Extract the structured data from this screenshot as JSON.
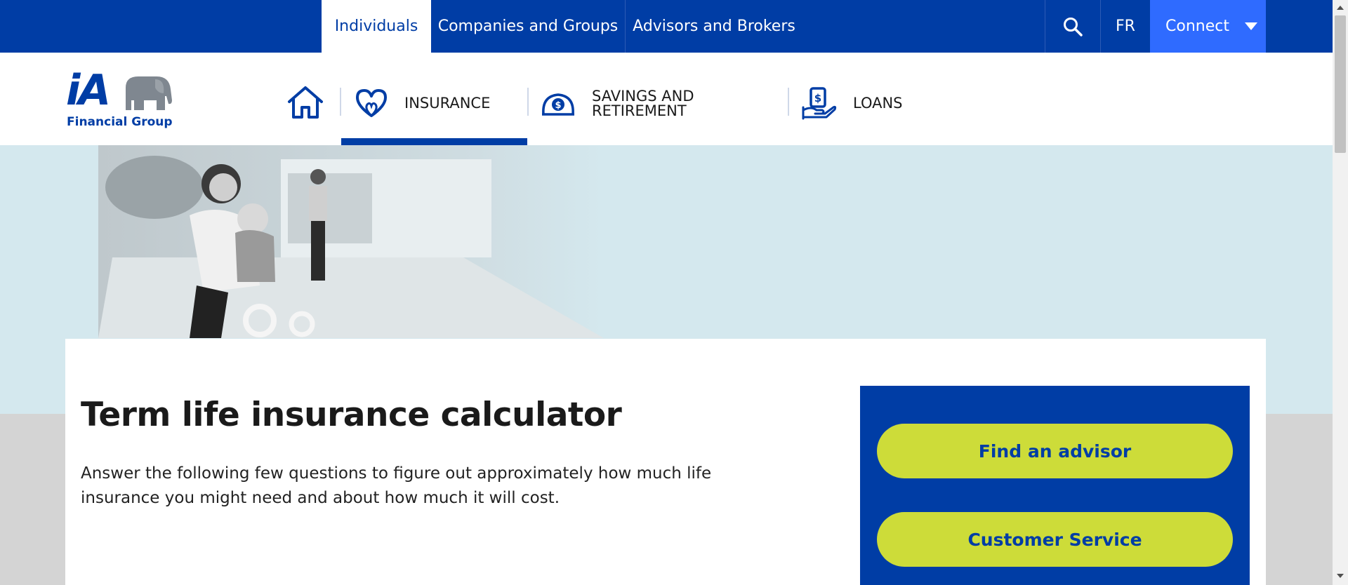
{
  "topbar": {
    "tabs": [
      {
        "label": "Individuals",
        "active": true
      },
      {
        "label": "Companies and Groups",
        "active": false
      },
      {
        "label": "Advisors and Brokers",
        "active": false
      }
    ],
    "search_icon": "search-icon",
    "language_label": "FR",
    "connect_label": "Connect",
    "colors": {
      "bar": "#003da5",
      "connect": "#2f6bff"
    }
  },
  "header": {
    "logo": {
      "mark": "iA",
      "subtitle": "Financial Group"
    },
    "nav": [
      {
        "label": "INSURANCE",
        "icon": "heart-icon",
        "active": true
      },
      {
        "label_line1": "SAVINGS AND",
        "label_line2": "RETIREMENT",
        "icon": "piggy-bank-icon"
      },
      {
        "label": "LOANS",
        "icon": "hand-money-icon"
      }
    ],
    "home_icon": "home-icon"
  },
  "main": {
    "title": "Term life insurance calculator",
    "intro": "Answer the following few questions to figure out approximately how much life insurance you might need and about how much it will cost.",
    "side_buttons": [
      {
        "label": "Find an advisor"
      },
      {
        "label": "Customer Service"
      }
    ],
    "colors": {
      "accent": "#cddc39",
      "panel": "#003da5",
      "hero": "#d4e8ee"
    }
  }
}
